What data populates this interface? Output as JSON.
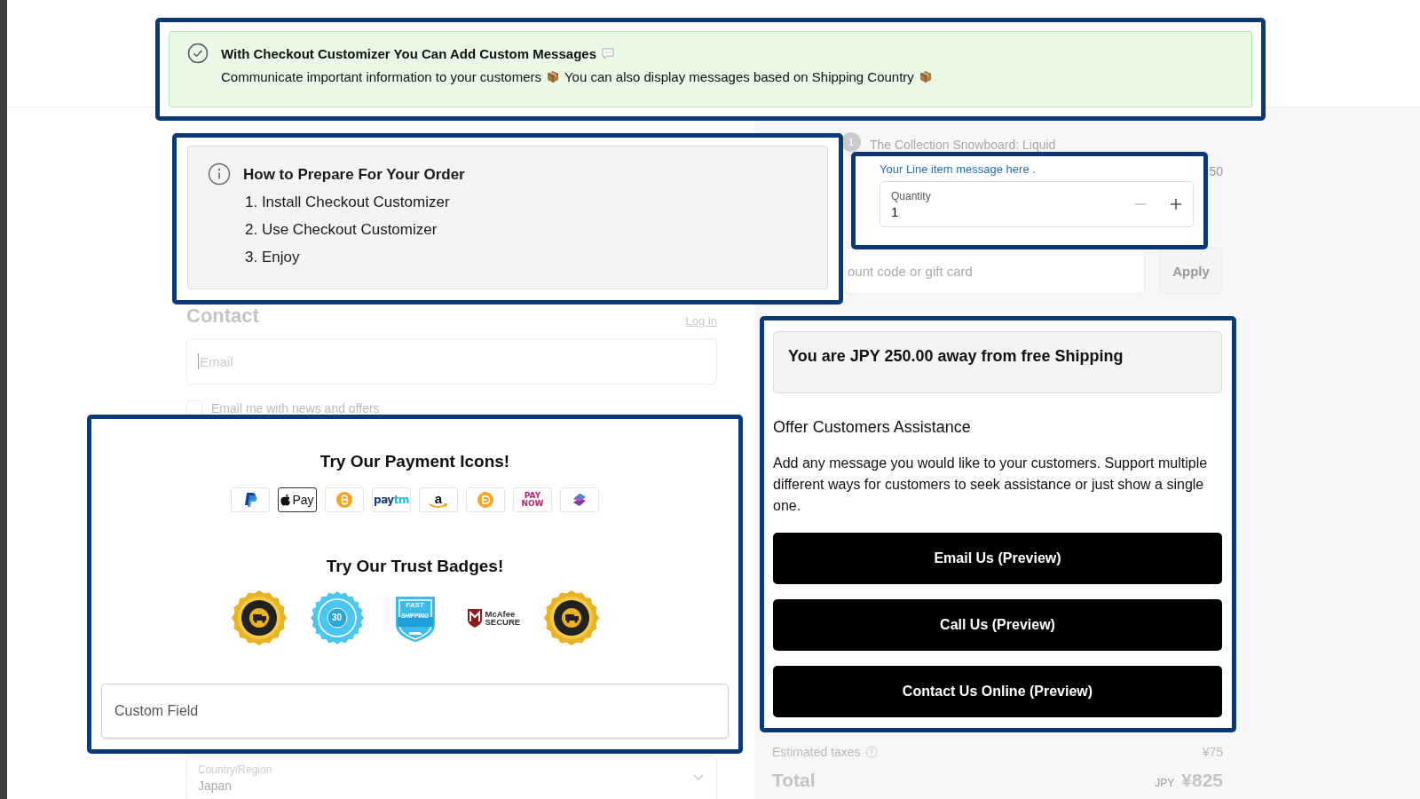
{
  "background_page": {
    "contact": {
      "heading": "Contact",
      "login_link": "Log in",
      "email_placeholder": "Email",
      "newsletter": {
        "label": "Email me with news and offers",
        "checked": false
      }
    },
    "country": {
      "label": "Country/Region",
      "value": "Japan"
    },
    "order_summary": {
      "item": {
        "quantity_badge": "1",
        "title": "The Collection Snowboard: Liquid",
        "price": "50"
      },
      "discount": {
        "placeholder": "ount code or gift card",
        "button": "Apply"
      },
      "taxes": {
        "label": "Estimated taxes",
        "value": "¥75"
      },
      "total": {
        "label": "Total",
        "currency": "JPY",
        "value": "¥825"
      }
    }
  },
  "highlights": {
    "message_banner": {
      "title": "With Checkout Customizer You Can Add Custom Messages",
      "text_parts": [
        "Communicate important information to your customers",
        "You can also display messages based on Shipping Country"
      ]
    },
    "instructions": {
      "title": "How to Prepare For Your Order",
      "steps": [
        "1. Install Checkout Customizer",
        "2. Use Checkout Customizer",
        "3. Enjoy"
      ]
    },
    "line_item": {
      "message": "Your Line item message here .",
      "quantity_label": "Quantity",
      "quantity": "1"
    },
    "trust": {
      "payment_title": "Try Our Payment Icons!",
      "payment_icons": [
        {
          "kind": "paypal"
        },
        {
          "kind": "apple-pay",
          "parts": [
            "Pay"
          ]
        },
        {
          "kind": "bitcoin"
        },
        {
          "kind": "paytm",
          "parts": [
            "pay",
            "tm"
          ]
        },
        {
          "kind": "amazon",
          "parts": [
            "a"
          ]
        },
        {
          "kind": "coin"
        },
        {
          "kind": "paynow",
          "parts": [
            "PAY",
            "NOW"
          ]
        },
        {
          "kind": "stack"
        }
      ],
      "badges_title": "Try Our Trust Badges!",
      "badges": [
        {
          "kind": "gold-seal"
        },
        {
          "kind": "blue-seal",
          "parts": [
            "30"
          ]
        },
        {
          "kind": "shield",
          "parts": [
            "FAST",
            "SHIPPING"
          ]
        },
        {
          "kind": "mcafee",
          "parts": [
            "McAfee",
            "SECURE"
          ]
        },
        {
          "kind": "gold-seal"
        }
      ],
      "custom_field_placeholder": "Custom Field"
    },
    "assistance": {
      "shipping_notice": "You are JPY 250.00 away from free Shipping",
      "title": "Offer Customers Assistance",
      "text": "Add any message you would like to your customers. Support multiple different ways for customers to seek assistance or just show a single one.",
      "buttons": [
        "Email Us (Preview)",
        "Call Us (Preview)",
        "Contact Us Online (Preview)"
      ]
    }
  }
}
